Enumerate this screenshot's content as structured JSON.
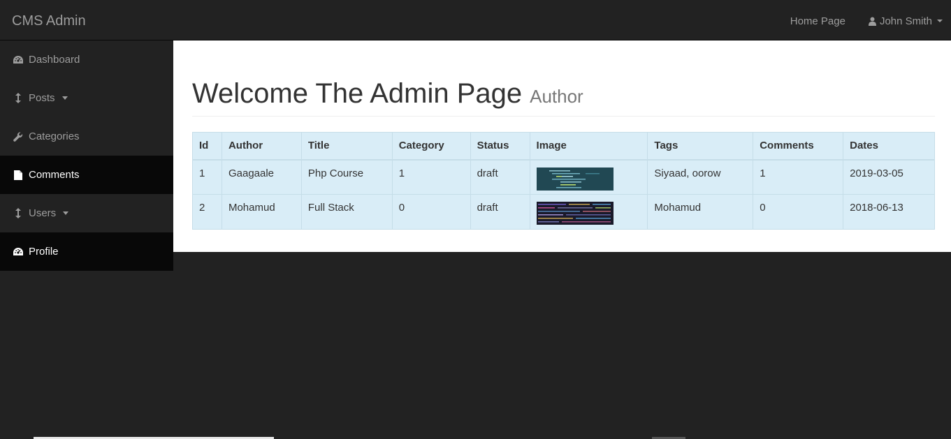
{
  "topbar": {
    "brand": "CMS Admin",
    "home_link": "Home Page",
    "user_name": "John Smith"
  },
  "sidebar": {
    "items": [
      {
        "label": "Dashboard",
        "icon": "dashboard-icon"
      },
      {
        "label": "Posts",
        "icon": "arrows-v-icon",
        "dropdown": true
      },
      {
        "label": "Categories",
        "icon": "wrench-icon"
      },
      {
        "label": "Comments",
        "icon": "file-icon"
      },
      {
        "label": "Users",
        "icon": "arrows-v-icon",
        "dropdown": true
      },
      {
        "label": "Profile",
        "icon": "dashboard-icon"
      }
    ]
  },
  "main": {
    "title": "Welcome The Admin Page",
    "subtitle": "Author",
    "table": {
      "headers": [
        "Id",
        "Author",
        "Title",
        "Category",
        "Status",
        "Image",
        "Tags",
        "Comments",
        "Dates"
      ],
      "rows": [
        {
          "id": "1",
          "author": "Gaagaale",
          "title": "Php Course",
          "category": "1",
          "status": "draft",
          "image": "code-screenshot-thumbnail",
          "tags": "Siyaad, oorow",
          "comments": "1",
          "date": "2019-03-05"
        },
        {
          "id": "2",
          "author": "Mohamud",
          "title": "Full Stack",
          "category": "0",
          "status": "draft",
          "image": "code-screenshot-thumbnail",
          "tags": "Mohamud",
          "comments": "0",
          "date": "2018-06-13"
        }
      ]
    }
  },
  "colors": {
    "navbar_bg": "#222222",
    "active_item_bg": "#080808",
    "table_row_bg": "#d9edf7"
  }
}
